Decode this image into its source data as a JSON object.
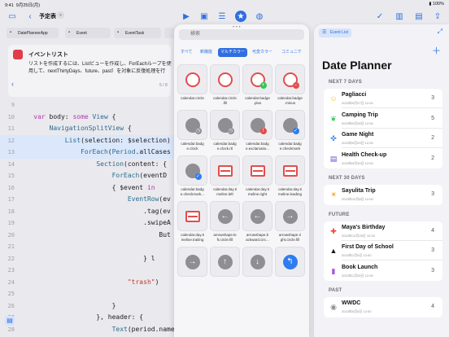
{
  "status": {
    "time": "9:41",
    "date": "9月25日(月)",
    "battery": "100%"
  },
  "toolbar": {
    "doc_title": "予定表",
    "icons": [
      "sidebar-icon",
      "back-icon",
      "chevron-down-icon",
      "play-icon",
      "stop-icon",
      "sliders-icon",
      "library-icon",
      "color-icon",
      "checkmark-icon",
      "books-icon",
      "bag-icon",
      "share-icon"
    ]
  },
  "tabs": [
    "DatePlannerApp",
    "Event",
    "EventTask",
    "Ev"
  ],
  "banner": {
    "title": "イベントリスト",
    "body": "リストを作成するには、Listビューを作成し、ForEachループを使用して、nextThirtyDays、future、past）を対象に反復処理を行",
    "page": "5 / 8"
  },
  "code": [
    {
      "ln": "9",
      "text": "",
      "hl": false
    },
    {
      "ln": "10",
      "text": "    var body: some View {",
      "hl": false
    },
    {
      "ln": "11",
      "text": "        NavigationSplitView {",
      "hl": false
    },
    {
      "ln": "12",
      "text": "            List(selection: $selection)",
      "hl": true
    },
    {
      "ln": "13",
      "text": "                ForEach(Period.allCases",
      "hl": true
    },
    {
      "ln": "14",
      "text": "                    Section(content: {",
      "hl": false
    },
    {
      "ln": "15",
      "text": "                        ForEach(eventD",
      "hl": false
    },
    {
      "ln": "16",
      "text": "                        { $event in",
      "hl": false
    },
    {
      "ln": "17",
      "text": "                            EventRow(ev",
      "hl": false
    },
    {
      "ln": "18",
      "text": "                                .tag(ev",
      "hl": false
    },
    {
      "ln": "19",
      "text": "                                .swipeA",
      "hl": false
    },
    {
      "ln": "20",
      "text": "                                    But",
      "hl": false
    },
    {
      "ln": "21",
      "text": "",
      "hl": false
    },
    {
      "ln": "22",
      "text": "                                } l",
      "hl": false
    },
    {
      "ln": "23",
      "text": "",
      "hl": false
    },
    {
      "ln": "24",
      "text": "                            \"trash\")",
      "hl": false
    },
    {
      "ln": "25",
      "text": "",
      "hl": false
    },
    {
      "ln": "26",
      "text": "                        }",
      "hl": false
    },
    {
      "ln": "27",
      "text": "                    }, header: {",
      "hl": false
    },
    {
      "ln": "28",
      "text": "                        Text(period.name)",
      "hl": false
    }
  ],
  "library": {
    "search_placeholder": "検索",
    "segments": [
      "すべて",
      "新機能",
      "マルチカラー",
      "可変カラー",
      "コミュニケ"
    ],
    "active_segment": "マルチカラー",
    "symbols": [
      {
        "name": "calendar.circle",
        "icon": "calendar-circle-icon"
      },
      {
        "name": "calendar.circle\n.fill",
        "icon": "calendar-circle-fill-icon"
      },
      {
        "name": "calendar.badge\n.plus",
        "icon": "calendar-badge-plus-icon"
      },
      {
        "name": "calendar.badge\n.minus",
        "icon": "calendar-badge-minus-icon"
      },
      {
        "name": "calendar.badg\ne.clock",
        "icon": "calendar-badge-clock-icon"
      },
      {
        "name": "calendar.badg\ne.clock.rtl",
        "icon": "calendar-badge-clock-rtl-icon"
      },
      {
        "name": "calendar.badg\ne.exclamatio...",
        "icon": "calendar-badge-exclamation-icon"
      },
      {
        "name": "calendar.badg\ne.checkmark",
        "icon": "calendar-badge-checkmark-icon"
      },
      {
        "name": "calendar.badg\ne.checkmark...",
        "icon": "calendar-badge-checkmark-rtl-icon"
      },
      {
        "name": "calendar.day.ti\nmeline.left",
        "icon": "timeline-left-icon"
      },
      {
        "name": "calendar.day.ti\nmeline.right",
        "icon": "timeline-right-icon"
      },
      {
        "name": "calendar.day.ti\nmeline.leading",
        "icon": "timeline-leading-icon"
      },
      {
        "name": "calendar.day.ti\nmeline.trailing",
        "icon": "timeline-trailing-icon"
      },
      {
        "name": "arrowshape.le\nft.circle.fill",
        "icon": "arrow-left-circle-icon"
      },
      {
        "name": "arrowshape.b\nackward.circ...",
        "icon": "arrow-backward-circle-icon"
      },
      {
        "name": "arrowshape.ri\nght.circle.fill",
        "icon": "arrow-right-circle-icon"
      },
      {
        "name": "",
        "icon": "arrow-right-circle-icon"
      },
      {
        "name": "",
        "icon": "arrow-up-circle-icon"
      },
      {
        "name": "",
        "icon": "arrow-down-circle-icon"
      },
      {
        "name": "",
        "icon": "arrow-turn-left-circle-icon"
      }
    ]
  },
  "preview": {
    "chip": "Event List",
    "title": "Date Planner",
    "sections": [
      {
        "label": "NEXT 7 DAYS",
        "rows": [
          {
            "name": "Pagliacci",
            "date": "2023年9月27日 12:00",
            "count": "3",
            "icon": "theater-masks-icon",
            "color": "#f5c518"
          },
          {
            "name": "Camping Trip",
            "date": "2023年9月28日 12:00",
            "count": "5",
            "icon": "leaf-icon",
            "color": "#34c759"
          },
          {
            "name": "Game Night",
            "date": "2023年9月29日 12:00",
            "count": "2",
            "icon": "gamecontroller-icon",
            "color": "#2f7cf0"
          },
          {
            "name": "Health Check-up",
            "date": "2023年9月30日 12:00",
            "count": "2",
            "icon": "list-clipboard-icon",
            "color": "#5856d6"
          }
        ]
      },
      {
        "label": "NEXT 30 DAYS",
        "rows": [
          {
            "name": "Sayulita Trip",
            "date": "2023年10月8日 12:00",
            "count": "3",
            "icon": "sun-icon",
            "color": "#ff9500"
          }
        ]
      },
      {
        "label": "FUTURE",
        "rows": [
          {
            "name": "Maya's Birthday",
            "date": "2023年10月25日 12:00",
            "count": "4",
            "icon": "gift-icon",
            "color": "#ff3b30"
          },
          {
            "name": "First Day of School",
            "date": "2024年1月5日 12:00",
            "count": "3",
            "icon": "graduationcap-icon",
            "color": "#1c1c1e"
          },
          {
            "name": "Book Launch",
            "date": "2024年1月25日 12:00",
            "count": "3",
            "icon": "book-icon",
            "color": "#af52de"
          }
        ]
      },
      {
        "label": "PAST",
        "rows": [
          {
            "name": "WWDC",
            "date": "2023年6月5日 12:00",
            "count": "4",
            "icon": "globe-icon",
            "color": "#8e8e93"
          }
        ]
      }
    ]
  }
}
